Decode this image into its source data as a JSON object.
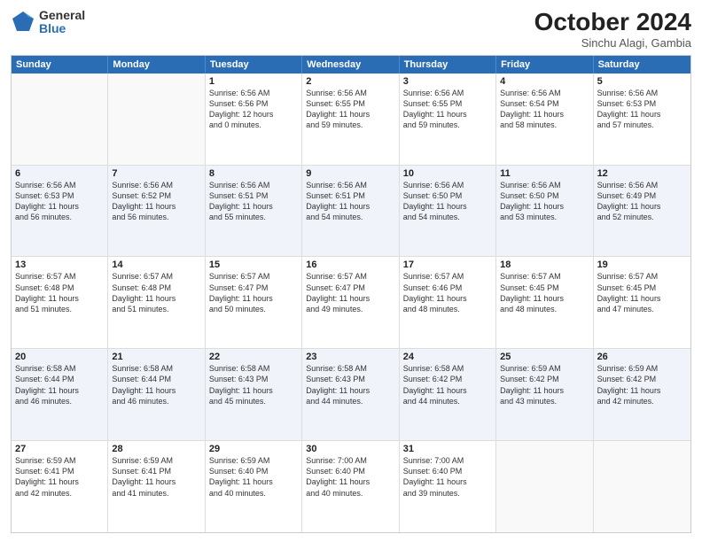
{
  "header": {
    "logo_line1": "General",
    "logo_line2": "Blue",
    "month_title": "October 2024",
    "location": "Sinchu Alagi, Gambia"
  },
  "weekdays": [
    "Sunday",
    "Monday",
    "Tuesday",
    "Wednesday",
    "Thursday",
    "Friday",
    "Saturday"
  ],
  "rows": [
    [
      {
        "day": "",
        "detail": ""
      },
      {
        "day": "",
        "detail": ""
      },
      {
        "day": "1",
        "detail": "Sunrise: 6:56 AM\nSunset: 6:56 PM\nDaylight: 12 hours\nand 0 minutes."
      },
      {
        "day": "2",
        "detail": "Sunrise: 6:56 AM\nSunset: 6:55 PM\nDaylight: 11 hours\nand 59 minutes."
      },
      {
        "day": "3",
        "detail": "Sunrise: 6:56 AM\nSunset: 6:55 PM\nDaylight: 11 hours\nand 59 minutes."
      },
      {
        "day": "4",
        "detail": "Sunrise: 6:56 AM\nSunset: 6:54 PM\nDaylight: 11 hours\nand 58 minutes."
      },
      {
        "day": "5",
        "detail": "Sunrise: 6:56 AM\nSunset: 6:53 PM\nDaylight: 11 hours\nand 57 minutes."
      }
    ],
    [
      {
        "day": "6",
        "detail": "Sunrise: 6:56 AM\nSunset: 6:53 PM\nDaylight: 11 hours\nand 56 minutes."
      },
      {
        "day": "7",
        "detail": "Sunrise: 6:56 AM\nSunset: 6:52 PM\nDaylight: 11 hours\nand 56 minutes."
      },
      {
        "day": "8",
        "detail": "Sunrise: 6:56 AM\nSunset: 6:51 PM\nDaylight: 11 hours\nand 55 minutes."
      },
      {
        "day": "9",
        "detail": "Sunrise: 6:56 AM\nSunset: 6:51 PM\nDaylight: 11 hours\nand 54 minutes."
      },
      {
        "day": "10",
        "detail": "Sunrise: 6:56 AM\nSunset: 6:50 PM\nDaylight: 11 hours\nand 54 minutes."
      },
      {
        "day": "11",
        "detail": "Sunrise: 6:56 AM\nSunset: 6:50 PM\nDaylight: 11 hours\nand 53 minutes."
      },
      {
        "day": "12",
        "detail": "Sunrise: 6:56 AM\nSunset: 6:49 PM\nDaylight: 11 hours\nand 52 minutes."
      }
    ],
    [
      {
        "day": "13",
        "detail": "Sunrise: 6:57 AM\nSunset: 6:48 PM\nDaylight: 11 hours\nand 51 minutes."
      },
      {
        "day": "14",
        "detail": "Sunrise: 6:57 AM\nSunset: 6:48 PM\nDaylight: 11 hours\nand 51 minutes."
      },
      {
        "day": "15",
        "detail": "Sunrise: 6:57 AM\nSunset: 6:47 PM\nDaylight: 11 hours\nand 50 minutes."
      },
      {
        "day": "16",
        "detail": "Sunrise: 6:57 AM\nSunset: 6:47 PM\nDaylight: 11 hours\nand 49 minutes."
      },
      {
        "day": "17",
        "detail": "Sunrise: 6:57 AM\nSunset: 6:46 PM\nDaylight: 11 hours\nand 48 minutes."
      },
      {
        "day": "18",
        "detail": "Sunrise: 6:57 AM\nSunset: 6:45 PM\nDaylight: 11 hours\nand 48 minutes."
      },
      {
        "day": "19",
        "detail": "Sunrise: 6:57 AM\nSunset: 6:45 PM\nDaylight: 11 hours\nand 47 minutes."
      }
    ],
    [
      {
        "day": "20",
        "detail": "Sunrise: 6:58 AM\nSunset: 6:44 PM\nDaylight: 11 hours\nand 46 minutes."
      },
      {
        "day": "21",
        "detail": "Sunrise: 6:58 AM\nSunset: 6:44 PM\nDaylight: 11 hours\nand 46 minutes."
      },
      {
        "day": "22",
        "detail": "Sunrise: 6:58 AM\nSunset: 6:43 PM\nDaylight: 11 hours\nand 45 minutes."
      },
      {
        "day": "23",
        "detail": "Sunrise: 6:58 AM\nSunset: 6:43 PM\nDaylight: 11 hours\nand 44 minutes."
      },
      {
        "day": "24",
        "detail": "Sunrise: 6:58 AM\nSunset: 6:42 PM\nDaylight: 11 hours\nand 44 minutes."
      },
      {
        "day": "25",
        "detail": "Sunrise: 6:59 AM\nSunset: 6:42 PM\nDaylight: 11 hours\nand 43 minutes."
      },
      {
        "day": "26",
        "detail": "Sunrise: 6:59 AM\nSunset: 6:42 PM\nDaylight: 11 hours\nand 42 minutes."
      }
    ],
    [
      {
        "day": "27",
        "detail": "Sunrise: 6:59 AM\nSunset: 6:41 PM\nDaylight: 11 hours\nand 42 minutes."
      },
      {
        "day": "28",
        "detail": "Sunrise: 6:59 AM\nSunset: 6:41 PM\nDaylight: 11 hours\nand 41 minutes."
      },
      {
        "day": "29",
        "detail": "Sunrise: 6:59 AM\nSunset: 6:40 PM\nDaylight: 11 hours\nand 40 minutes."
      },
      {
        "day": "30",
        "detail": "Sunrise: 7:00 AM\nSunset: 6:40 PM\nDaylight: 11 hours\nand 40 minutes."
      },
      {
        "day": "31",
        "detail": "Sunrise: 7:00 AM\nSunset: 6:40 PM\nDaylight: 11 hours\nand 39 minutes."
      },
      {
        "day": "",
        "detail": ""
      },
      {
        "day": "",
        "detail": ""
      }
    ]
  ]
}
